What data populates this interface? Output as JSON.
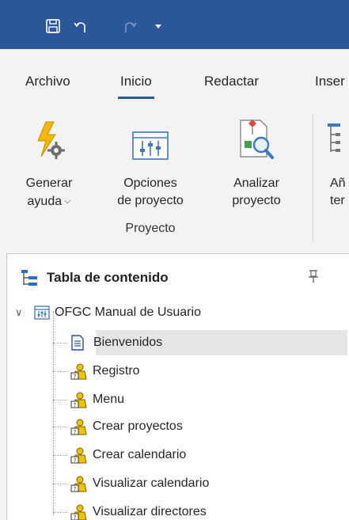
{
  "tabs": [
    {
      "label": "Archivo"
    },
    {
      "label": "Inicio"
    },
    {
      "label": "Redactar"
    },
    {
      "label": "Inser"
    }
  ],
  "ribbon": {
    "buttons": [
      {
        "line1": "Generar",
        "line2": "ayuda",
        "dropdown": true
      },
      {
        "line1": "Opciones",
        "line2": "de proyecto"
      },
      {
        "line1": "Analizar",
        "line2": "proyecto"
      },
      {
        "line1": "Añ",
        "line2": "ter"
      }
    ],
    "group_label": "Proyecto"
  },
  "toc": {
    "title": "Tabla de contenido",
    "root": "OFGC Manual de Usuario",
    "items": [
      {
        "label": "Bienvenidos",
        "icon": "document-icon",
        "selected": true
      },
      {
        "label": "Registro",
        "icon": "person-help-icon"
      },
      {
        "label": "Menu",
        "icon": "person-help-icon"
      },
      {
        "label": "Crear proyectos",
        "icon": "person-help-icon"
      },
      {
        "label": "Crear calendario",
        "icon": "person-help-icon"
      },
      {
        "label": "Visualizar calendario",
        "icon": "person-help-icon"
      },
      {
        "label": "Visualizar directores",
        "icon": "person-help-icon"
      }
    ]
  },
  "colors": {
    "accent": "#2b579a",
    "selection": "#e5e5e5"
  }
}
